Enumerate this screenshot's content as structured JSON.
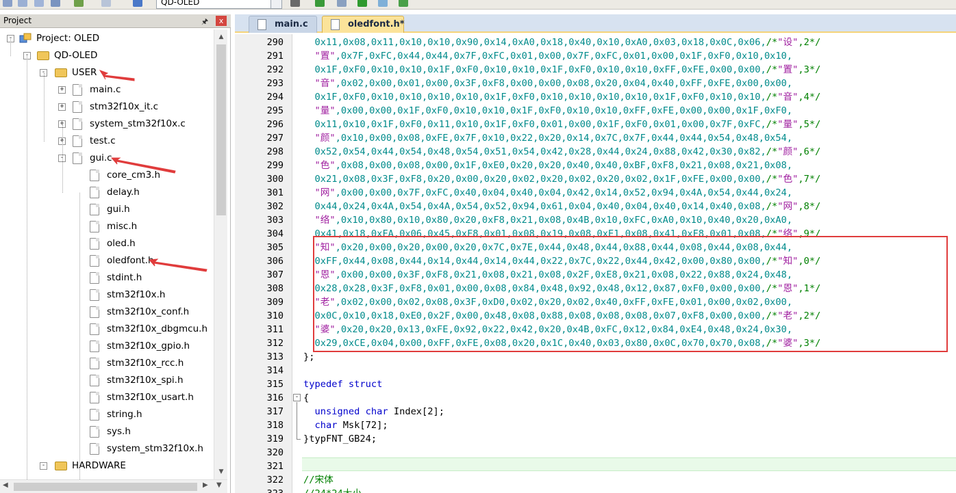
{
  "toolbar": {
    "target_name": "QD-OLED",
    "icons": [
      "rebuild-icon",
      "batch-build-icon",
      "translate-icon",
      "download-icon",
      "target-options-icon",
      "manage-components-icon",
      "pack-installer-icon",
      "select-packs-icon",
      "debug-icon"
    ]
  },
  "project_panel": {
    "title": "Project",
    "pin_icon": "pin-icon",
    "close_glyph": "x",
    "tree": [
      {
        "label": "Project: OLED",
        "icon": "project-icon",
        "expand": "-"
      },
      {
        "label": "QD-OLED",
        "icon": "target-folder-icon",
        "expand": "-"
      },
      {
        "label": "USER",
        "icon": "folder-icon",
        "expand": "-"
      },
      {
        "label": "main.c",
        "icon": "file-icon",
        "expand": "+"
      },
      {
        "label": "stm32f10x_it.c",
        "icon": "file-icon",
        "expand": "+"
      },
      {
        "label": "system_stm32f10x.c",
        "icon": "file-icon",
        "expand": "+"
      },
      {
        "label": "test.c",
        "icon": "file-icon",
        "expand": "+"
      },
      {
        "label": "gui.c",
        "icon": "file-icon",
        "expand": "-"
      },
      {
        "label": "core_cm3.h",
        "icon": "file-icon",
        "expand": ""
      },
      {
        "label": "delay.h",
        "icon": "file-icon",
        "expand": ""
      },
      {
        "label": "gui.h",
        "icon": "file-icon",
        "expand": ""
      },
      {
        "label": "misc.h",
        "icon": "file-icon",
        "expand": ""
      },
      {
        "label": "oled.h",
        "icon": "file-icon",
        "expand": ""
      },
      {
        "label": "oledfont.h",
        "icon": "file-icon",
        "expand": ""
      },
      {
        "label": "stdint.h",
        "icon": "file-icon",
        "expand": ""
      },
      {
        "label": "stm32f10x.h",
        "icon": "file-icon",
        "expand": ""
      },
      {
        "label": "stm32f10x_conf.h",
        "icon": "file-icon",
        "expand": ""
      },
      {
        "label": "stm32f10x_dbgmcu.h",
        "icon": "file-icon",
        "expand": ""
      },
      {
        "label": "stm32f10x_gpio.h",
        "icon": "file-icon",
        "expand": ""
      },
      {
        "label": "stm32f10x_rcc.h",
        "icon": "file-icon",
        "expand": ""
      },
      {
        "label": "stm32f10x_spi.h",
        "icon": "file-icon",
        "expand": ""
      },
      {
        "label": "stm32f10x_usart.h",
        "icon": "file-icon",
        "expand": ""
      },
      {
        "label": "string.h",
        "icon": "file-icon",
        "expand": ""
      },
      {
        "label": "sys.h",
        "icon": "file-icon",
        "expand": ""
      },
      {
        "label": "system_stm32f10x.h",
        "icon": "file-icon",
        "expand": ""
      },
      {
        "label": "HARDWARE",
        "icon": "folder-icon",
        "expand": "-"
      }
    ]
  },
  "editor": {
    "tabs": [
      {
        "label": "main.c",
        "active": false
      },
      {
        "label": "oledfont.h*",
        "active": true
      }
    ],
    "lines": [
      {
        "num": "290",
        "segs": [
          [
            "hex",
            "  0x11,0x08,0x11,0x10,0x10,0x90,0x14,0xA0,0x18,0x40,0x10,0xA0,0x03,0x18,0x0C,0x06,"
          ],
          [
            "cmt",
            "/*"
          ],
          [
            "str",
            "\"设\""
          ],
          [
            "cmt",
            ",2*/"
          ]
        ]
      },
      {
        "num": "291",
        "segs": [
          [
            "str",
            "  \"置\""
          ],
          [
            "hex",
            ",0x7F,0xFC,0x44,0x44,0x7F,0xFC,0x01,0x00,0x7F,0xFC,0x01,0x00,0x1F,0xF0,0x10,0x10,"
          ]
        ]
      },
      {
        "num": "292",
        "segs": [
          [
            "hex",
            "  0x1F,0xF0,0x10,0x10,0x1F,0xF0,0x10,0x10,0x1F,0xF0,0x10,0x10,0xFF,0xFE,0x00,0x00,"
          ],
          [
            "cmt",
            "/*"
          ],
          [
            "str",
            "\"置\""
          ],
          [
            "cmt",
            ",3*/"
          ]
        ]
      },
      {
        "num": "293",
        "segs": [
          [
            "str",
            "  \"音\""
          ],
          [
            "hex",
            ",0x02,0x00,0x01,0x00,0x3F,0xF8,0x00,0x00,0x08,0x20,0x04,0x40,0xFF,0xFE,0x00,0x00,"
          ]
        ]
      },
      {
        "num": "294",
        "segs": [
          [
            "hex",
            "  0x1F,0xF0,0x10,0x10,0x10,0x10,0x1F,0xF0,0x10,0x10,0x10,0x10,0x1F,0xF0,0x10,0x10,"
          ],
          [
            "cmt",
            "/*"
          ],
          [
            "str",
            "\"音\""
          ],
          [
            "cmt",
            ",4*/"
          ]
        ]
      },
      {
        "num": "295",
        "segs": [
          [
            "str",
            "  \"量\""
          ],
          [
            "hex",
            ",0x00,0x00,0x1F,0xF0,0x10,0x10,0x1F,0xF0,0x10,0x10,0xFF,0xFE,0x00,0x00,0x1F,0xF0,"
          ]
        ]
      },
      {
        "num": "296",
        "segs": [
          [
            "hex",
            "  0x11,0x10,0x1F,0xF0,0x11,0x10,0x1F,0xF0,0x01,0x00,0x1F,0xF0,0x01,0x00,0x7F,0xFC,"
          ],
          [
            "cmt",
            "/*"
          ],
          [
            "str",
            "\"量\""
          ],
          [
            "cmt",
            ",5*/"
          ]
        ]
      },
      {
        "num": "297",
        "segs": [
          [
            "str",
            "  \"颜\""
          ],
          [
            "hex",
            ",0x10,0x00,0x08,0xFE,0x7F,0x10,0x22,0x20,0x14,0x7C,0x7F,0x44,0x44,0x54,0x48,0x54,"
          ]
        ]
      },
      {
        "num": "298",
        "segs": [
          [
            "hex",
            "  0x52,0x54,0x44,0x54,0x48,0x54,0x51,0x54,0x42,0x28,0x44,0x24,0x88,0x42,0x30,0x82,"
          ],
          [
            "cmt",
            "/*"
          ],
          [
            "str",
            "\"颜\""
          ],
          [
            "cmt",
            ",6*/"
          ]
        ]
      },
      {
        "num": "299",
        "segs": [
          [
            "str",
            "  \"色\""
          ],
          [
            "hex",
            ",0x08,0x00,0x08,0x00,0x1F,0xE0,0x20,0x20,0x40,0x40,0xBF,0xF8,0x21,0x08,0x21,0x08,"
          ]
        ]
      },
      {
        "num": "300",
        "segs": [
          [
            "hex",
            "  0x21,0x08,0x3F,0xF8,0x20,0x00,0x20,0x02,0x20,0x02,0x20,0x02,0x1F,0xFE,0x00,0x00,"
          ],
          [
            "cmt",
            "/*"
          ],
          [
            "str",
            "\"色\""
          ],
          [
            "cmt",
            ",7*/"
          ]
        ]
      },
      {
        "num": "301",
        "segs": [
          [
            "str",
            "  \"网\""
          ],
          [
            "hex",
            ",0x00,0x00,0x7F,0xFC,0x40,0x04,0x40,0x04,0x42,0x14,0x52,0x94,0x4A,0x54,0x44,0x24,"
          ]
        ]
      },
      {
        "num": "302",
        "segs": [
          [
            "hex",
            "  0x44,0x24,0x4A,0x54,0x4A,0x54,0x52,0x94,0x61,0x04,0x40,0x04,0x40,0x14,0x40,0x08,"
          ],
          [
            "cmt",
            "/*"
          ],
          [
            "str",
            "\"网\""
          ],
          [
            "cmt",
            ",8*/"
          ]
        ]
      },
      {
        "num": "303",
        "segs": [
          [
            "str",
            "  \"络\""
          ],
          [
            "hex",
            ",0x10,0x80,0x10,0x80,0x20,0xF8,0x21,0x08,0x4B,0x10,0xFC,0xA0,0x10,0x40,0x20,0xA0,"
          ]
        ]
      },
      {
        "num": "304",
        "segs": [
          [
            "hex",
            "  0x41,0x18,0xFA,0x06,0x45,0xF8,0x01,0x08,0x19,0x08,0xE1,0x08,0x41,0xF8,0x01,0x08,"
          ],
          [
            "cmt",
            "/*"
          ],
          [
            "str",
            "\"络\""
          ],
          [
            "cmt",
            ",9*/"
          ]
        ]
      },
      {
        "num": "305",
        "segs": [
          [
            "str",
            "  \"知\""
          ],
          [
            "hex",
            ",0x20,0x00,0x20,0x00,0x20,0x7C,0x7E,0x44,0x48,0x44,0x88,0x44,0x08,0x44,0x08,0x44,"
          ]
        ]
      },
      {
        "num": "306",
        "segs": [
          [
            "hex",
            "  0xFF,0x44,0x08,0x44,0x14,0x44,0x14,0x44,0x22,0x7C,0x22,0x44,0x42,0x00,0x80,0x00,"
          ],
          [
            "cmt",
            "/*"
          ],
          [
            "str",
            "\"知\""
          ],
          [
            "cmt",
            ",0*/"
          ]
        ]
      },
      {
        "num": "307",
        "segs": [
          [
            "str",
            "  \"恩\""
          ],
          [
            "hex",
            ",0x00,0x00,0x3F,0xF8,0x21,0x08,0x21,0x08,0x2F,0xE8,0x21,0x08,0x22,0x88,0x24,0x48,"
          ]
        ]
      },
      {
        "num": "308",
        "segs": [
          [
            "hex",
            "  0x28,0x28,0x3F,0xF8,0x01,0x00,0x08,0x84,0x48,0x92,0x48,0x12,0x87,0xF0,0x00,0x00,"
          ],
          [
            "cmt",
            "/*"
          ],
          [
            "str",
            "\"恩\""
          ],
          [
            "cmt",
            ",1*/"
          ]
        ]
      },
      {
        "num": "309",
        "segs": [
          [
            "str",
            "  \"老\""
          ],
          [
            "hex",
            ",0x02,0x00,0x02,0x08,0x3F,0xD0,0x02,0x20,0x02,0x40,0xFF,0xFE,0x01,0x00,0x02,0x00,"
          ]
        ]
      },
      {
        "num": "310",
        "segs": [
          [
            "hex",
            "  0x0C,0x10,0x18,0xE0,0x2F,0x00,0x48,0x08,0x88,0x08,0x08,0x08,0x07,0xF8,0x00,0x00,"
          ],
          [
            "cmt",
            "/*"
          ],
          [
            "str",
            "\"老\""
          ],
          [
            "cmt",
            ",2*/"
          ]
        ]
      },
      {
        "num": "311",
        "segs": [
          [
            "str",
            "  \"婆\""
          ],
          [
            "hex",
            ",0x20,0x20,0x13,0xFE,0x92,0x22,0x42,0x20,0x4B,0xFC,0x12,0x84,0xE4,0x48,0x24,0x30,"
          ]
        ]
      },
      {
        "num": "312",
        "segs": [
          [
            "hex",
            "  0x29,0xCE,0x04,0x00,0xFF,0xFE,0x08,0x20,0x1C,0x40,0x03,0x80,0x0C,0x70,0x70,0x08,"
          ],
          [
            "cmt",
            "/*"
          ],
          [
            "str",
            "\"婆\""
          ],
          [
            "cmt",
            ",3*/"
          ]
        ]
      },
      {
        "num": "313",
        "segs": [
          [
            "plain",
            "};"
          ]
        ]
      },
      {
        "num": "314",
        "segs": [
          [
            "plain",
            ""
          ]
        ]
      },
      {
        "num": "315",
        "segs": [
          [
            "kw",
            "typedef struct"
          ]
        ]
      },
      {
        "num": "316",
        "segs": [
          [
            "plain",
            "{"
          ]
        ]
      },
      {
        "num": "317",
        "segs": [
          [
            "kw",
            "  unsigned char"
          ],
          [
            "plain",
            " Index[2];"
          ]
        ]
      },
      {
        "num": "318",
        "segs": [
          [
            "kw",
            "  char"
          ],
          [
            "plain",
            " Msk[72];"
          ]
        ]
      },
      {
        "num": "319",
        "segs": [
          [
            "plain",
            "}typFNT_GB24;"
          ]
        ]
      },
      {
        "num": "320",
        "segs": [
          [
            "plain",
            ""
          ]
        ]
      },
      {
        "num": "321",
        "segs": [
          [
            "plain",
            ""
          ]
        ]
      },
      {
        "num": "322",
        "segs": [
          [
            "cmt",
            "//宋体"
          ]
        ]
      },
      {
        "num": "323",
        "segs": [
          [
            "cmt",
            "//24*24大小"
          ]
        ]
      }
    ]
  },
  "colors": {
    "hex_constant": "#008b8b",
    "string_literal": "#a020a0",
    "keyword": "#0000cc",
    "comment": "#008000",
    "annotation_red": "#e03c3c",
    "active_tab": "#fbe39a",
    "current_line": "#e9fae9"
  }
}
